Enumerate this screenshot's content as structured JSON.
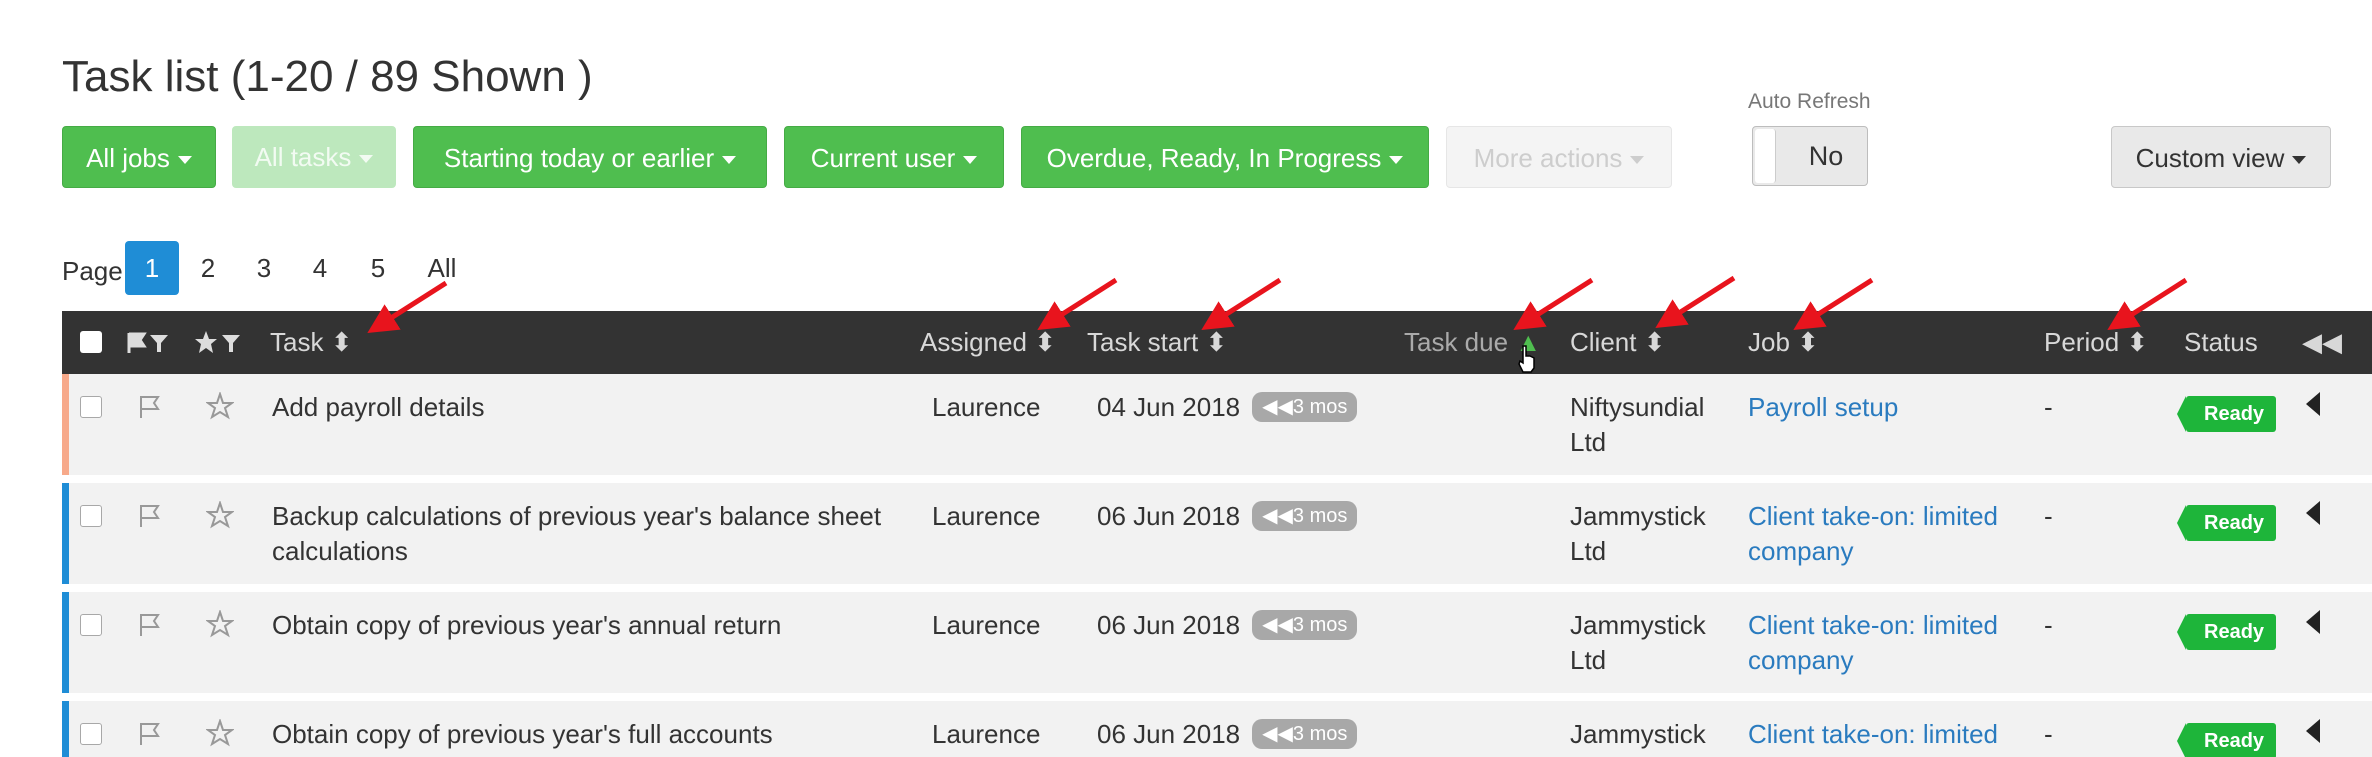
{
  "page": {
    "title": "Task list (1-20 / 89 Shown )"
  },
  "filters": {
    "all_jobs": "All jobs",
    "all_tasks": "All tasks",
    "starting": "Starting today or earlier",
    "current_user": "Current user",
    "statuses": "Overdue, Ready, In Progress",
    "more_actions": "More actions",
    "custom_view": "Custom view"
  },
  "auto_refresh": {
    "label": "Auto Refresh",
    "value": "No"
  },
  "pagination": {
    "label": "Page",
    "pages": [
      "1",
      "2",
      "3",
      "4",
      "5",
      "All"
    ],
    "current": "1"
  },
  "table": {
    "columns": {
      "task": "Task",
      "assigned": "Assigned",
      "task_start": "Task start",
      "task_due": "Task due",
      "client": "Client",
      "job": "Job",
      "period": "Period",
      "status": "Status"
    },
    "rows": [
      {
        "task": "Add payroll details",
        "assigned": "Laurence",
        "start": "04 Jun 2018",
        "ago": "3 mos",
        "client": "Niftysundial Ltd",
        "job": "Payroll setup",
        "period": "-",
        "status": "Ready",
        "accent": "#f7a98a"
      },
      {
        "task": "Backup calculations of previous year's balance sheet calculations",
        "assigned": "Laurence",
        "start": "06 Jun 2018",
        "ago": "3 mos",
        "client": "Jammystick Ltd",
        "job": "Client take-on: limited company",
        "period": "-",
        "status": "Ready",
        "accent": "#1f8dd6"
      },
      {
        "task": "Obtain copy of previous year's annual return",
        "assigned": "Laurence",
        "start": "06 Jun 2018",
        "ago": "3 mos",
        "client": "Jammystick Ltd",
        "job": "Client take-on: limited company",
        "period": "-",
        "status": "Ready",
        "accent": "#1f8dd6"
      },
      {
        "task": "Obtain copy of previous year's full accounts",
        "assigned": "Laurence",
        "start": "06 Jun 2018",
        "ago": "3 mos",
        "client": "Jammystick Ltd",
        "job": "Client take-on: limited company",
        "period": "-",
        "status": "Ready",
        "accent": "#1f8dd6"
      }
    ]
  },
  "colors": {
    "green": "#4fbe4f",
    "header": "#333333",
    "active_page": "#1f8dd6",
    "ready": "#1eb53a",
    "link": "#2a7bbf",
    "annotation": "#e8141d"
  }
}
